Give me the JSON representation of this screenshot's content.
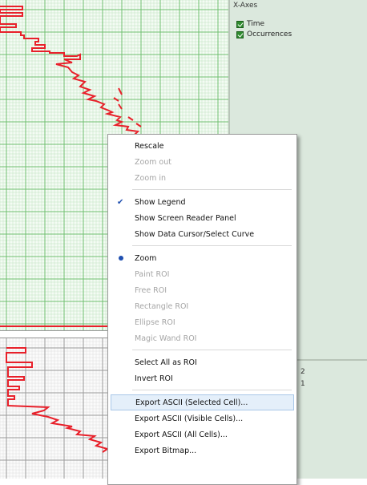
{
  "right_panel": {
    "xaxes_label": "X-Axes",
    "legend_items": [
      {
        "label": "Time",
        "checked": true
      },
      {
        "label": "Occurrences",
        "checked": true
      }
    ],
    "lower_values": [
      "2",
      "1"
    ]
  },
  "context_menu": {
    "items": [
      {
        "label": "Rescale",
        "enabled": true
      },
      {
        "label": "Zoom out",
        "enabled": false
      },
      {
        "label": "Zoom in",
        "enabled": false
      },
      {
        "label": "Show Legend",
        "enabled": true,
        "checked": true
      },
      {
        "label": "Show Screen Reader Panel",
        "enabled": true
      },
      {
        "label": "Show Data Cursor/Select Curve",
        "enabled": true
      },
      {
        "label": "Zoom",
        "enabled": true,
        "selected": true
      },
      {
        "label": "Paint ROI",
        "enabled": false
      },
      {
        "label": "Free ROI",
        "enabled": false
      },
      {
        "label": "Rectangle ROI",
        "enabled": false
      },
      {
        "label": "Ellipse ROI",
        "enabled": false
      },
      {
        "label": "Magic Wand ROI",
        "enabled": false
      },
      {
        "label": "Select All as ROI",
        "enabled": true
      },
      {
        "label": "Invert ROI",
        "enabled": true
      },
      {
        "label": "Export ASCII (Selected Cell)...",
        "enabled": true,
        "highlighted": true
      },
      {
        "label": "Export ASCII (Visible Cells)...",
        "enabled": true
      },
      {
        "label": "Export ASCII (All Cells)...",
        "enabled": true
      },
      {
        "label": "Export Bitmap...",
        "enabled": true
      }
    ]
  },
  "colors": {
    "curve": "#e8202a",
    "grid_major": "#6fbf6f",
    "grid_minor": "#bfe3bf",
    "panel": "#dbe8dd",
    "menu_highlight": "#e4effa"
  }
}
